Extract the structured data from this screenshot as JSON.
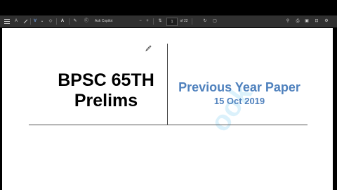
{
  "toolbar": {
    "ask_copilot_label": "Ask Copilot",
    "page_current": "1",
    "page_total_label": "of 22"
  },
  "document": {
    "title_line1": "BPSC 65TH",
    "title_line2": "Prelims",
    "subtitle": "Previous Year Paper",
    "date": "15 Oct 2019"
  },
  "colors": {
    "accent_blue": "#4f81bd",
    "toolbar_bg": "#303030"
  }
}
